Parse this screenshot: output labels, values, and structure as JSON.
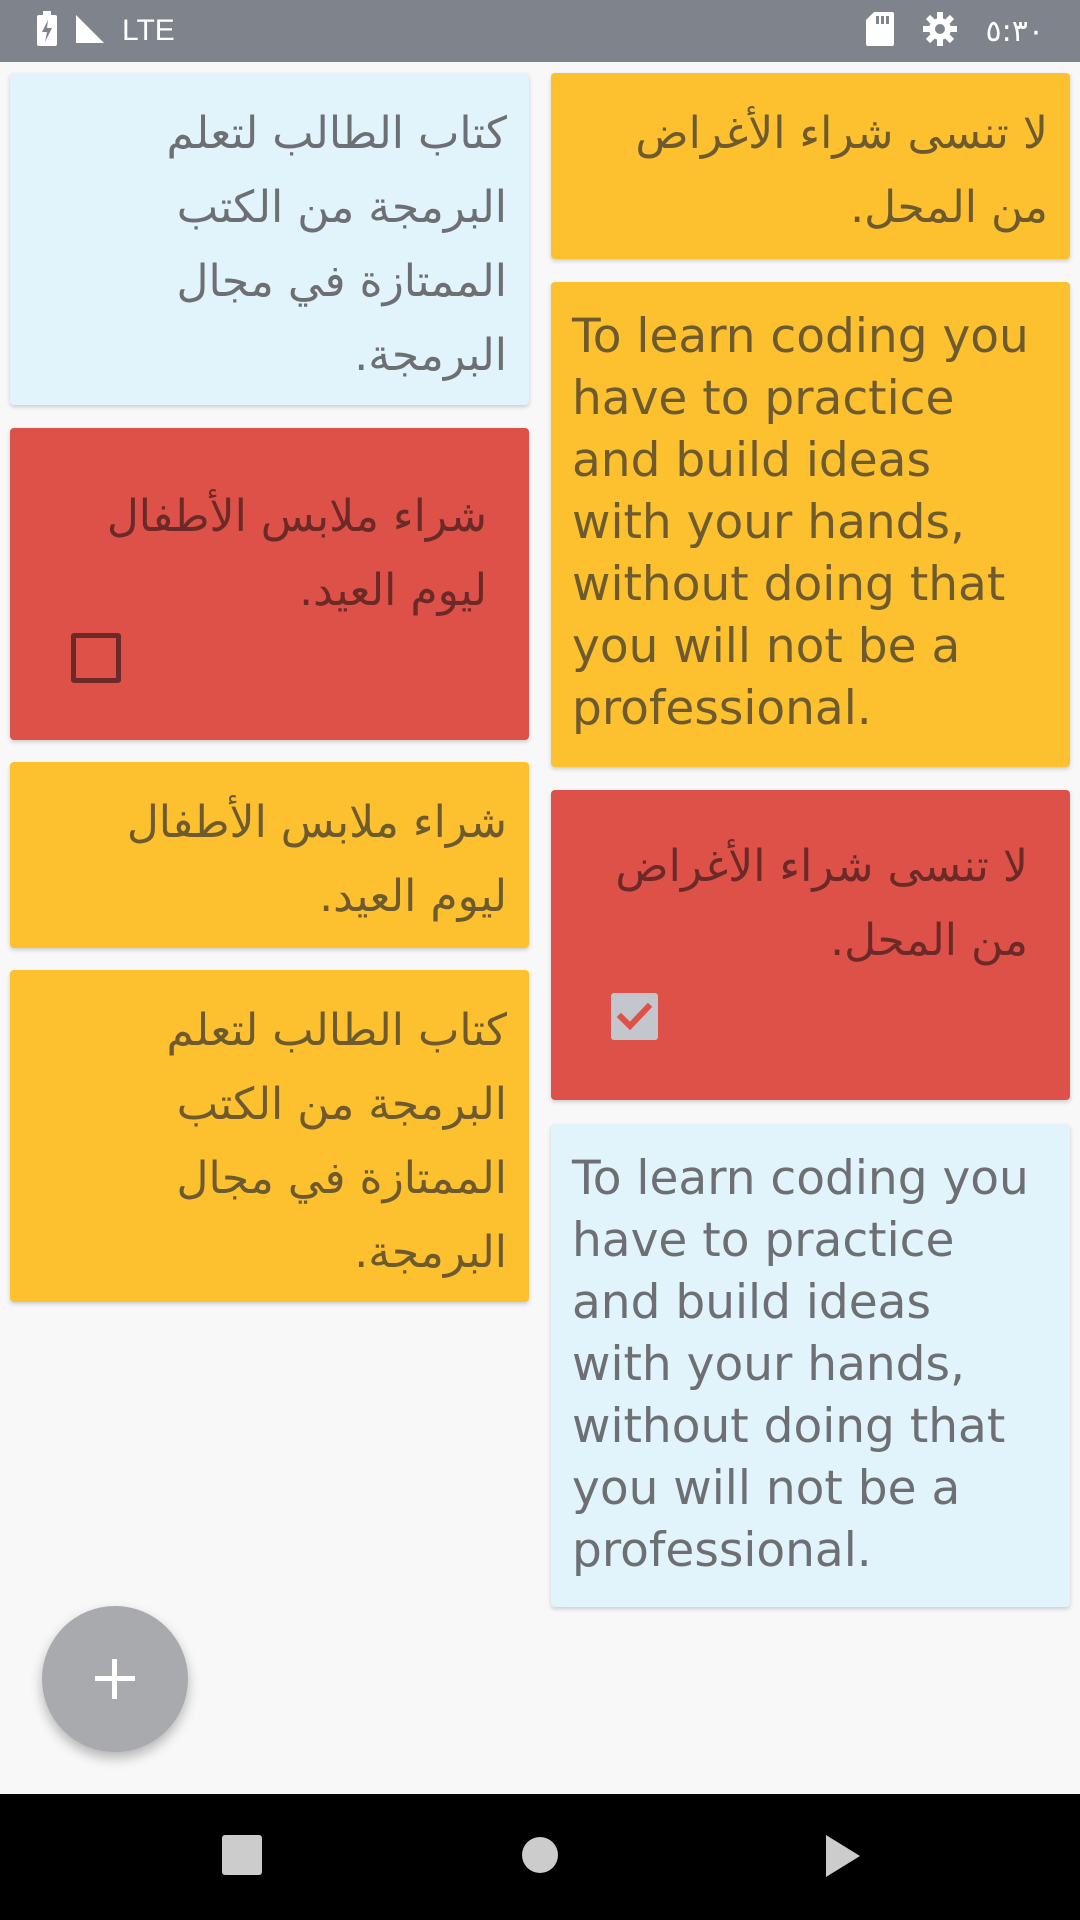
{
  "status_bar": {
    "network": "LTE",
    "time": "٥:٣٠",
    "icons": [
      "battery-charging-icon",
      "signal-icon",
      "sd-card-icon",
      "settings-icon"
    ]
  },
  "notes": [
    {
      "column": "left",
      "color": "blue",
      "text": "كتاب الطالب لتعلم\nالبرمجة من الكتب\nالممتازة في مجال\nالبرمجة."
    },
    {
      "column": "left",
      "color": "red",
      "text": "شراء ملابس الأطفال\nليوم العيد.",
      "checkbox": "unchecked"
    },
    {
      "column": "left",
      "color": "yellow",
      "text": "شراء ملابس الأطفال\nليوم العيد."
    },
    {
      "column": "left",
      "color": "yellow",
      "text": "كتاب الطالب لتعلم\nالبرمجة من الكتب\nالممتازة في مجال\nالبرمجة."
    },
    {
      "column": "right",
      "color": "yellow",
      "text": "لا تنسى شراء الأغراض\nمن المحل."
    },
    {
      "column": "right",
      "color": "yellow",
      "text": "To learn coding you\nhave to practice\nand build ideas\nwith your hands,\nwithout doing that\nyou will not be a\nprofessional."
    },
    {
      "column": "right",
      "color": "red",
      "text": "لا تنسى شراء الأغراض\nمن المحل.",
      "checkbox": "checked"
    },
    {
      "column": "right",
      "color": "blue",
      "text": "To learn coding you\nhave to practice\nand build ideas\nwith your hands,\nwithout doing that\nyou will not be a\nprofessional."
    }
  ],
  "colors": {
    "yellow": "#fdc12f",
    "blue": "#e1f3fb",
    "red": "#dd5148",
    "status_bar": "#7f848c",
    "fab": "#a8aaad"
  },
  "fab": {
    "icon": "plus-icon"
  },
  "nav_bar": {
    "buttons": [
      "recent-apps-icon",
      "home-icon",
      "back-icon"
    ]
  }
}
